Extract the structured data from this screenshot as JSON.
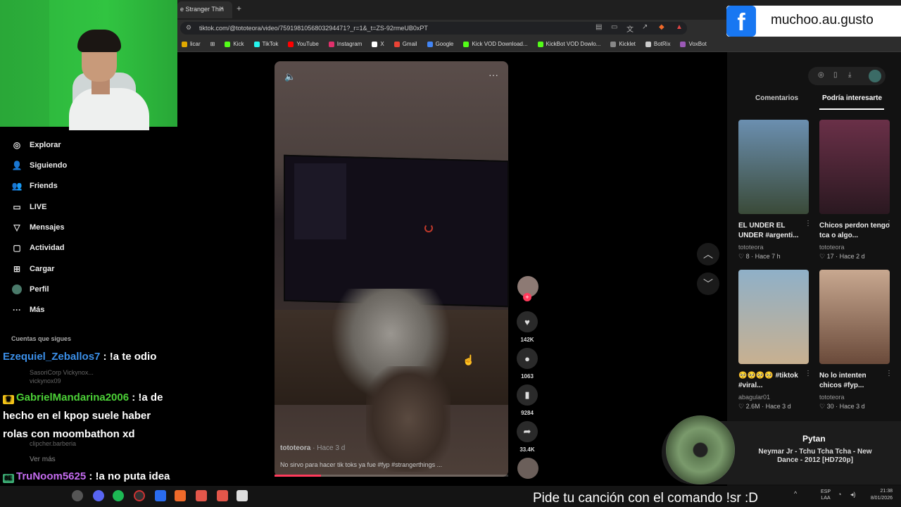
{
  "browser": {
    "tab_label": "e Stranger Thin",
    "tab_close": "×",
    "new_tab": "+",
    "url": "tiktok.com/@tototeora/video/7591981056803294471?_r=1&_t=ZS-92rmeUB0xPT",
    "bookmarks": [
      "licar",
      "Kick",
      "TikTok",
      "YouTube",
      "Instagram",
      "X",
      "Gmail",
      "Google",
      "Kick VOD Download...",
      "KickBot VOD Dowlo...",
      "Kicklet",
      "BotRix",
      "VoxBot"
    ],
    "bookmark_colors": [
      "#e0a800",
      "#53fc18",
      "#25f4ee",
      "#ff0000",
      "#e1306c",
      "#ffffff",
      "#ea4335",
      "#4285f4",
      "#53fc18",
      "#53fc18",
      "#888888",
      "#cccccc",
      "#9b59b6"
    ]
  },
  "facebook_banner": {
    "logo_letter": "f",
    "handle": "muchoo.au.gusto"
  },
  "sidebar": {
    "items": [
      {
        "label": "Explorar",
        "icon": "compass-icon"
      },
      {
        "label": "Siguiendo",
        "icon": "following-icon"
      },
      {
        "label": "Friends",
        "icon": "friends-icon"
      },
      {
        "label": "LIVE",
        "icon": "live-icon"
      },
      {
        "label": "Mensajes",
        "icon": "messages-icon"
      },
      {
        "label": "Actividad",
        "icon": "activity-icon"
      },
      {
        "label": "Cargar",
        "icon": "upload-icon"
      },
      {
        "label": "Perfil",
        "icon": "profile-icon"
      },
      {
        "label": "Más",
        "icon": "more-icon"
      }
    ],
    "following_heading": "Cuentas que sigues",
    "following_partial": [
      "SasoriCorp Vickynox...",
      "vickynox09",
      "clipcher.barberia"
    ],
    "see_more": "Ver más"
  },
  "chat": [
    {
      "user": "Ezequiel_Zeballos7",
      "message": " : !a te odio",
      "color": "#3b8fe8",
      "badge": ""
    },
    {
      "user": "GabrielMandarina2006",
      "message": " : !a de hecho en el kpop suele haber rolas con moombathon xd",
      "color": "#4cd137",
      "badge": "crown"
    },
    {
      "user": "TruNoom5625",
      "message": " : !a no puta idea wacho",
      "color": "#c56cf0",
      "badge": "tag"
    }
  ],
  "video": {
    "author": "tototeora",
    "time": " · Hace 3 d",
    "caption": "No sirvo para hacer tik toks ya fue #fyp #strangerthings ...",
    "progress": 0.2,
    "likes": "142K",
    "comments": "1063",
    "saves": "9284",
    "shares": "33.4K"
  },
  "right_panel": {
    "tab_comments": "Comentarios",
    "tab_interest": "Podría interesarte",
    "cards": [
      {
        "title": "EL UNDER EL UNDER #argenti...",
        "author": "tototeora",
        "stats": "♡ 8 · Hace 7 h",
        "color1": "#6b8fb0",
        "color2": "#3a4a38"
      },
      {
        "title": "Chicos perdon tengo tca o algo...",
        "author": "tototeora",
        "stats": "♡ 17 · Hace 2 d",
        "color1": "#6a3048",
        "color2": "#2a1820"
      },
      {
        "title": "🥺🥺🥺🥺 #tiktok #viral...",
        "author": "abagular01",
        "stats": "♡ 2.6M · Hace 3 d",
        "color1": "#8fb0c8",
        "color2": "#c8b090"
      },
      {
        "title": "No lo intenten chicos #fyp...",
        "author": "tototeora",
        "stats": "♡ 30 · Hace 3 d",
        "color1": "#c8a890",
        "color2": "#6a4a3a"
      }
    ]
  },
  "song": {
    "title": "Pytan",
    "subtitle": "Neymar Jr - Tchu Tcha Tcha - New Dance - 2012 [HD720p]"
  },
  "stream_overlay": {
    "bottom_message": "Pide tu canción con el comando !sr :D"
  },
  "taskbar": {
    "lang_top": "ESP",
    "lang_bottom": "LAA",
    "time": "21:38",
    "date": "8/01/2026"
  }
}
